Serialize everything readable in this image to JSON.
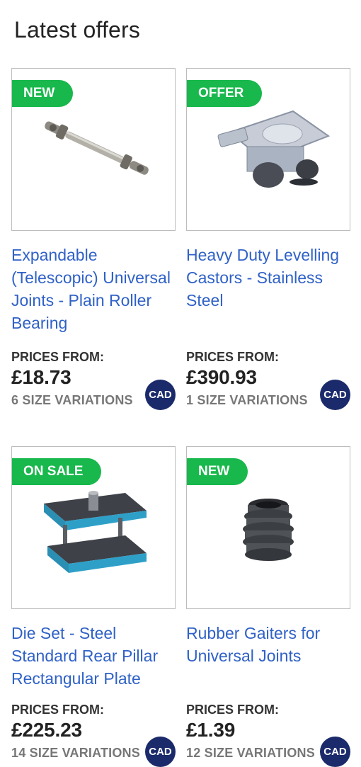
{
  "section": {
    "title": "Latest offers"
  },
  "products": [
    {
      "badge": "NEW",
      "title": "Expandable (Telescopic) Universal Joints - Plain Roller Bearing",
      "prices_from": "PRICES FROM:",
      "price": "£18.73",
      "variations": "6 SIZE VARIATIONS",
      "cad": "CAD",
      "icon": "telescopic-universal-joint-image"
    },
    {
      "badge": "OFFER",
      "title": "Heavy Duty Levelling Castors - Stainless Steel",
      "prices_from": "PRICES FROM:",
      "price": "£390.93",
      "variations": "1 SIZE VARIATIONS",
      "cad": "CAD",
      "icon": "levelling-castor-image"
    },
    {
      "badge": "ON SALE",
      "title": "Die Set - Steel Standard Rear Pillar Rectangular Plate",
      "prices_from": "PRICES FROM:",
      "price": "£225.23",
      "variations": "14 SIZE VARIATIONS",
      "cad": "CAD",
      "icon": "die-set-image"
    },
    {
      "badge": "NEW",
      "title": "Rubber Gaiters for Universal Joints",
      "prices_from": "PRICES FROM:",
      "price": "£1.39",
      "variations": "12 SIZE VARIATIONS",
      "cad": "CAD",
      "icon": "rubber-gaiter-image"
    }
  ],
  "colors": {
    "badge": "#18b84c",
    "title_link": "#2f61c7",
    "cad_badge": "#1b2a6b"
  }
}
